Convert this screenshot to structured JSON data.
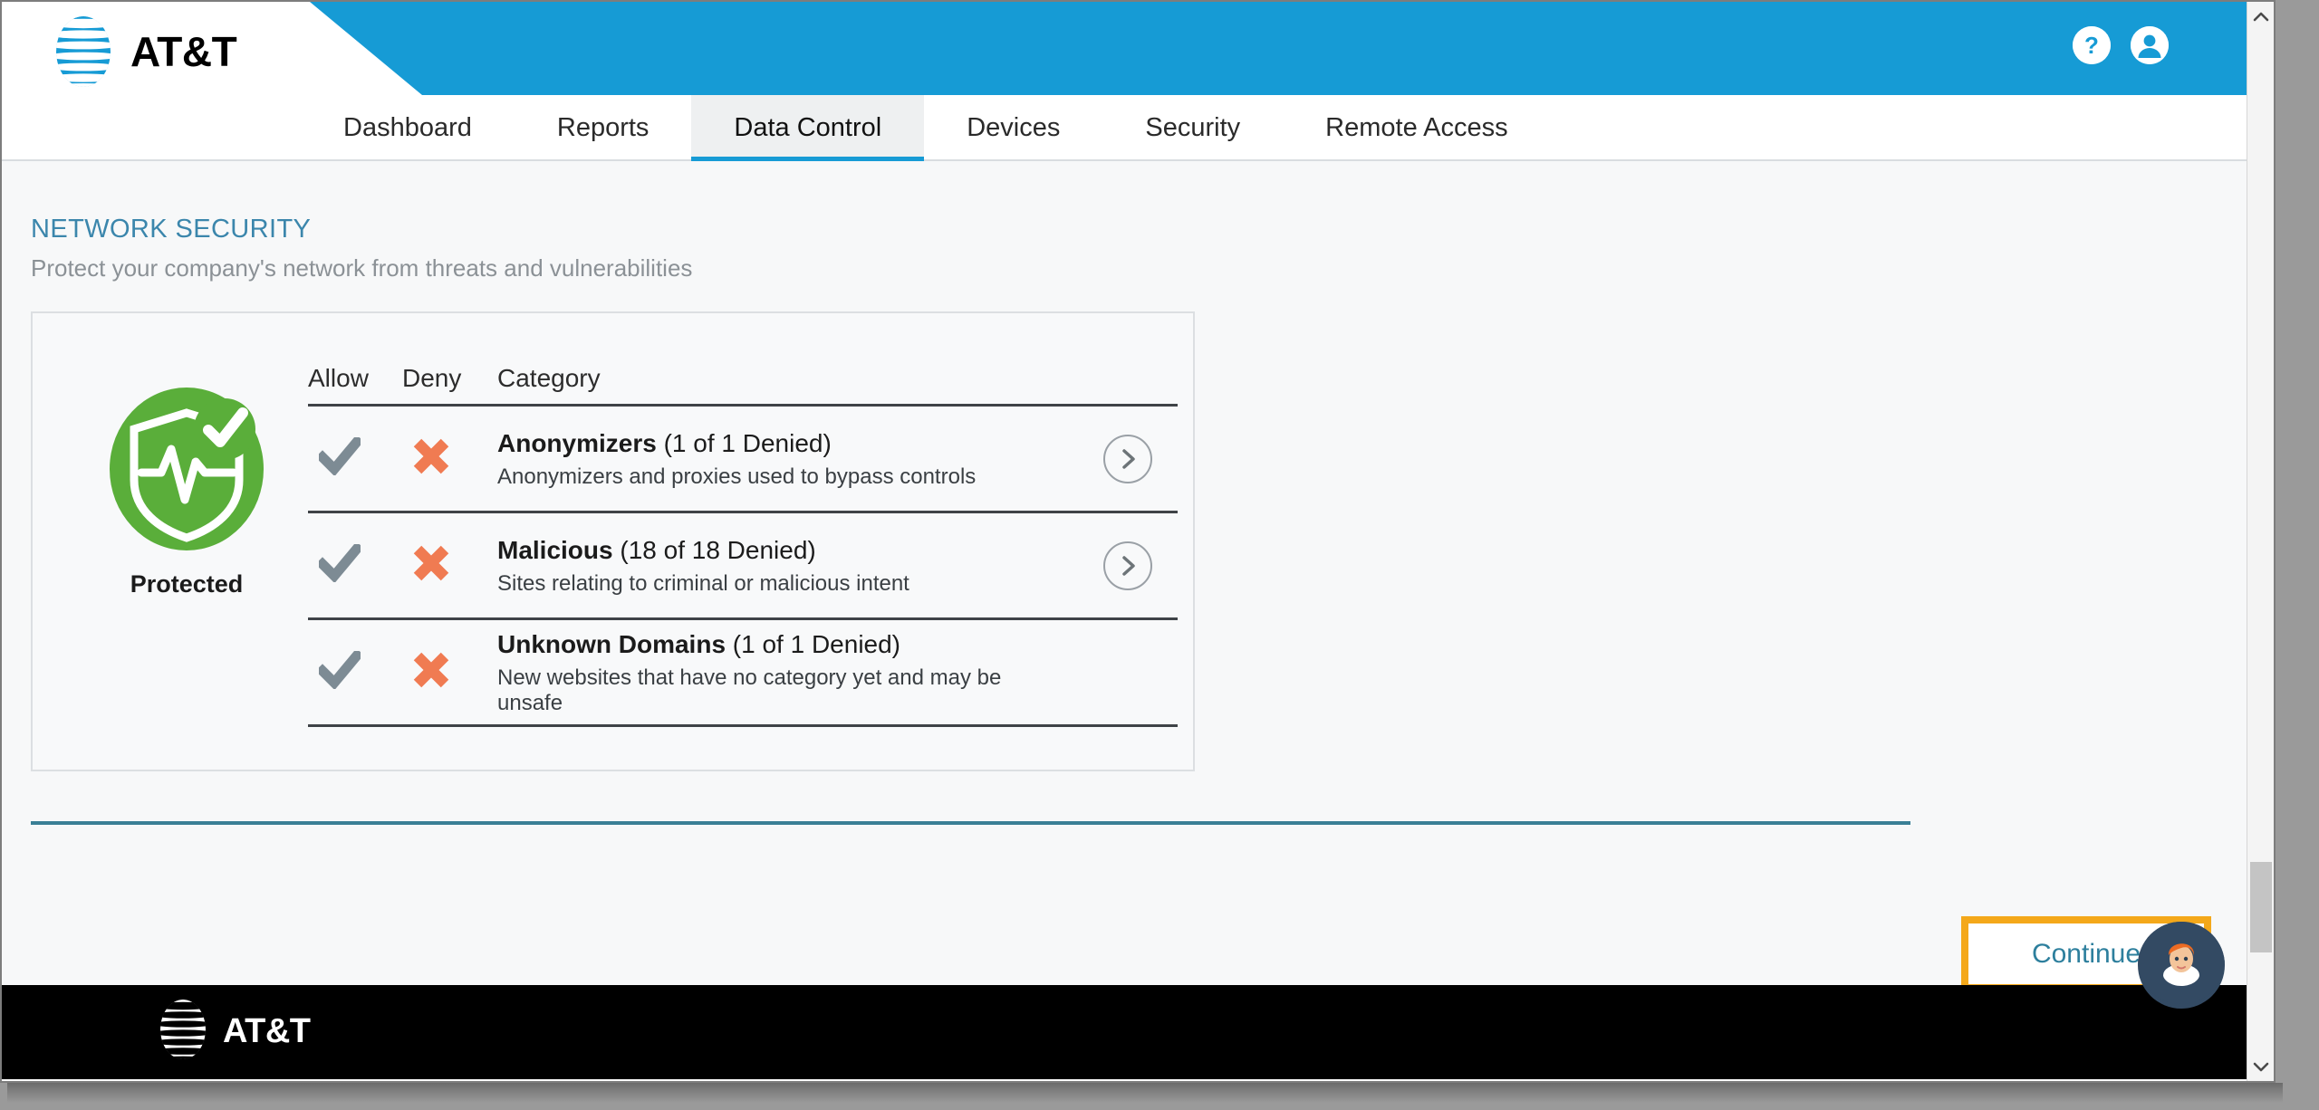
{
  "brand": {
    "name": "AT&T",
    "header_blue": "#169bd5",
    "accent_teal": "#3a7f96",
    "highlight_orange": "#f4a81a"
  },
  "header": {
    "help_icon": "help-circle-icon",
    "account_icon": "account-circle-icon"
  },
  "nav": {
    "tabs": [
      {
        "label": "Dashboard",
        "active": false
      },
      {
        "label": "Reports",
        "active": false
      },
      {
        "label": "Data Control",
        "active": true
      },
      {
        "label": "Devices",
        "active": false
      },
      {
        "label": "Security",
        "active": false
      },
      {
        "label": "Remote Access",
        "active": false
      }
    ]
  },
  "page": {
    "title": "NETWORK SECURITY",
    "subtitle": "Protect your company's network from threats and vulnerabilities"
  },
  "status": {
    "icon": "shield-pulse-check-icon",
    "label": "Protected",
    "color": "#5aae3a"
  },
  "table": {
    "headers": {
      "allow": "Allow",
      "deny": "Deny",
      "category": "Category"
    },
    "rows": [
      {
        "allow_icon": "check-icon",
        "deny_icon": "cross-icon",
        "name": "Anonymizers",
        "count_text": "(1 of 1 Denied)",
        "denied": 1,
        "total": 1,
        "description": "Anonymizers and proxies used to bypass controls",
        "arrow_icon": "chevron-right-circle-icon"
      },
      {
        "allow_icon": "check-icon",
        "deny_icon": "cross-icon",
        "name": "Malicious",
        "count_text": "(18 of 18 Denied)",
        "denied": 18,
        "total": 18,
        "description": "Sites relating to criminal or malicious intent",
        "arrow_icon": "chevron-right-circle-icon"
      },
      {
        "allow_icon": "check-icon",
        "deny_icon": "cross-icon",
        "name": "Unknown Domains",
        "count_text": "(1 of 1 Denied)",
        "denied": 1,
        "total": 1,
        "description": "New websites that have no category yet and may be unsafe",
        "arrow_icon": "chevron-right-circle-icon"
      }
    ]
  },
  "actions": {
    "continue_label": "Continue"
  },
  "chat": {
    "icon": "agent-avatar-icon"
  },
  "footer": {
    "brand": "AT&T"
  },
  "scrollbar": {
    "up_icon": "chevron-up-icon",
    "down_icon": "chevron-down-icon"
  }
}
